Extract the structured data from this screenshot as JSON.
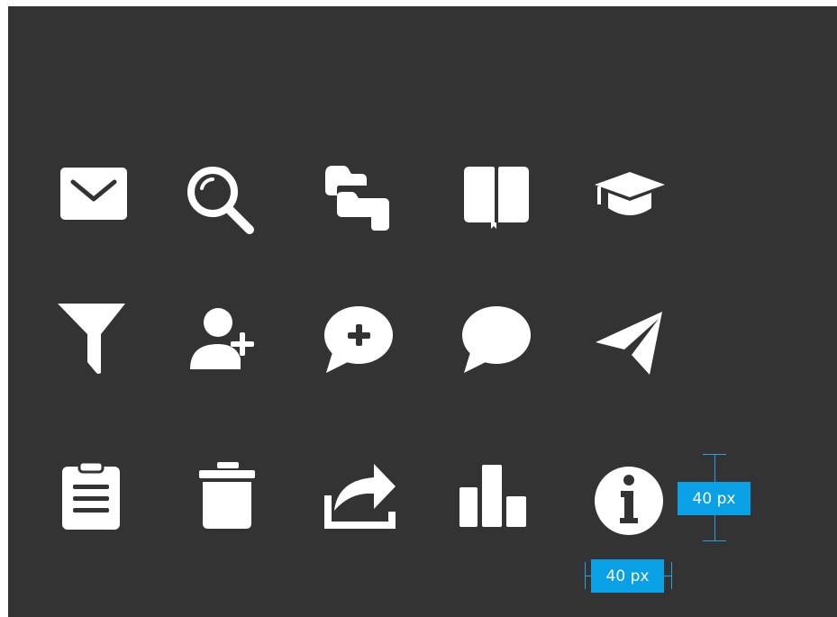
{
  "colors": {
    "background": "#333333",
    "icon": "#ffffff",
    "accent": "#0aa0e6"
  },
  "icons": [
    [
      "mail-icon",
      "search-icon",
      "folders-icon",
      "book-icon",
      "graduation-cap-icon"
    ],
    [
      "filter-icon",
      "add-user-icon",
      "add-comment-icon",
      "comment-icon",
      "send-icon"
    ],
    [
      "clipboard-icon",
      "trash-icon",
      "share-icon",
      "bar-chart-icon",
      "info-icon"
    ]
  ],
  "measurements": {
    "height_label": "40 px",
    "width_label": "40 px"
  }
}
